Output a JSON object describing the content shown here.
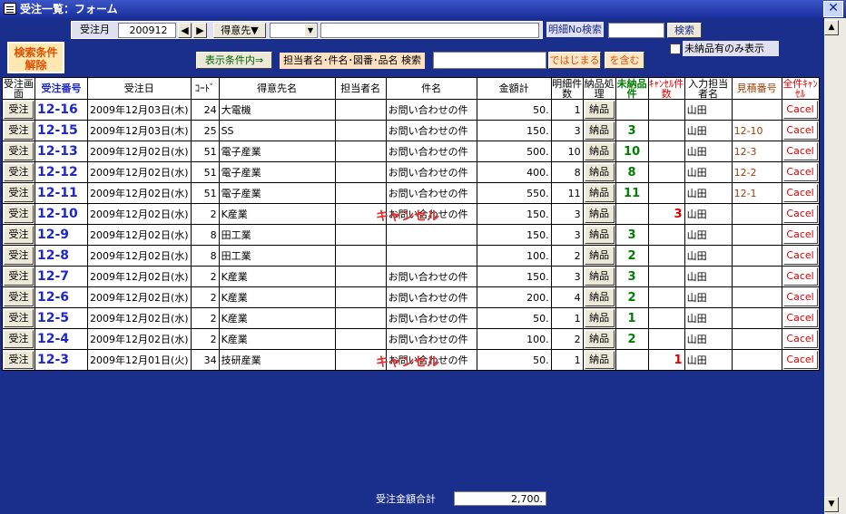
{
  "window": {
    "title": "受注一覧：フォーム"
  },
  "header": {
    "clear_button": "検索条件解除",
    "month_label": "受注月",
    "month_value": "200912",
    "customer_button": "得意先▼",
    "detail_search_label": "明細No検索",
    "search_button": "検索",
    "display_condition_button": "表示条件内⇒",
    "field_search_label": "担当者名･件名･図番･品名 検索",
    "starts_with_button": "ではじまる",
    "contains_button": "を含む",
    "undelivered_only_label": "未納品有のみ表示"
  },
  "columns": [
    "受注画面",
    "受注番号",
    "受注日",
    "ｺｰﾄﾞ",
    "得意先名",
    "担当者名",
    "件名",
    "金額計",
    "明細件数",
    "納品処理",
    "未納品件",
    "ｷｬﾝｾﾙ件数",
    "入力担当者名",
    "見積番号",
    "全件ｷｬﾝｾﾙ"
  ],
  "row_button": "受注",
  "deliver_button": "納品",
  "cancel_button": "Cacel",
  "cancel_mark": "キャンセル",
  "rows": [
    {
      "no": "12-16",
      "date": "2009年12月03日(木)",
      "code": "24",
      "customer": "大電機",
      "staff": "",
      "subject": "お問い合わせの件",
      "amount": "50.",
      "lines": "1",
      "undelivered": "",
      "cancelled": "",
      "input_staff": "山田",
      "estimate": ""
    },
    {
      "no": "12-15",
      "date": "2009年12月03日(木)",
      "code": "25",
      "customer": "SS",
      "staff": "",
      "subject": "お問い合わせの件",
      "amount": "150.",
      "lines": "3",
      "undelivered": "3",
      "cancelled": "",
      "input_staff": "山田",
      "estimate": "12-10"
    },
    {
      "no": "12-13",
      "date": "2009年12月02日(水)",
      "code": "51",
      "customer": "電子産業",
      "staff": "",
      "subject": "お問い合わせの件",
      "amount": "500.",
      "lines": "10",
      "undelivered": "10",
      "cancelled": "",
      "input_staff": "山田",
      "estimate": "12-3"
    },
    {
      "no": "12-12",
      "date": "2009年12月02日(水)",
      "code": "51",
      "customer": "電子産業",
      "staff": "",
      "subject": "お問い合わせの件",
      "amount": "400.",
      "lines": "8",
      "undelivered": "8",
      "cancelled": "",
      "input_staff": "山田",
      "estimate": "12-2"
    },
    {
      "no": "12-11",
      "date": "2009年12月02日(水)",
      "code": "51",
      "customer": "電子産業",
      "staff": "",
      "subject": "お問い合わせの件",
      "amount": "550.",
      "lines": "11",
      "undelivered": "11",
      "cancelled": "",
      "input_staff": "山田",
      "estimate": "12-1"
    },
    {
      "no": "12-10",
      "date": "2009年12月02日(水)",
      "code": "2",
      "customer": "K産業",
      "staff": "",
      "subject": "お問い合わせの件",
      "amount": "150.",
      "lines": "3",
      "undelivered": "",
      "cancelled": "3",
      "input_staff": "山田",
      "estimate": ""
    },
    {
      "no": "12-9",
      "date": "2009年12月02日(水)",
      "code": "8",
      "customer": "田工業",
      "staff": "",
      "subject": "",
      "amount": "150.",
      "lines": "3",
      "undelivered": "3",
      "cancelled": "",
      "input_staff": "山田",
      "estimate": ""
    },
    {
      "no": "12-8",
      "date": "2009年12月02日(水)",
      "code": "8",
      "customer": "田工業",
      "staff": "",
      "subject": "",
      "amount": "100.",
      "lines": "2",
      "undelivered": "2",
      "cancelled": "",
      "input_staff": "山田",
      "estimate": ""
    },
    {
      "no": "12-7",
      "date": "2009年12月02日(水)",
      "code": "2",
      "customer": "K産業",
      "staff": "",
      "subject": "お問い合わせの件",
      "amount": "150.",
      "lines": "3",
      "undelivered": "3",
      "cancelled": "",
      "input_staff": "山田",
      "estimate": ""
    },
    {
      "no": "12-6",
      "date": "2009年12月02日(水)",
      "code": "2",
      "customer": "K産業",
      "staff": "",
      "subject": "お問い合わせの件",
      "amount": "200.",
      "lines": "4",
      "undelivered": "2",
      "cancelled": "",
      "input_staff": "山田",
      "estimate": ""
    },
    {
      "no": "12-5",
      "date": "2009年12月02日(水)",
      "code": "2",
      "customer": "K産業",
      "staff": "",
      "subject": "お問い合わせの件",
      "amount": "50.",
      "lines": "1",
      "undelivered": "1",
      "cancelled": "",
      "input_staff": "山田",
      "estimate": ""
    },
    {
      "no": "12-4",
      "date": "2009年12月02日(水)",
      "code": "2",
      "customer": "K産業",
      "staff": "",
      "subject": "お問い合わせの件",
      "amount": "100.",
      "lines": "2",
      "undelivered": "2",
      "cancelled": "",
      "input_staff": "山田",
      "estimate": ""
    },
    {
      "no": "12-3",
      "date": "2009年12月01日(火)",
      "code": "34",
      "customer": "技研産業",
      "staff": "",
      "subject": "お問い合わせの件",
      "amount": "50.",
      "lines": "1",
      "undelivered": "",
      "cancelled": "1",
      "input_staff": "山田",
      "estimate": ""
    }
  ],
  "footer": {
    "total_label": "受注金額合計",
    "total_value": "2,700."
  }
}
